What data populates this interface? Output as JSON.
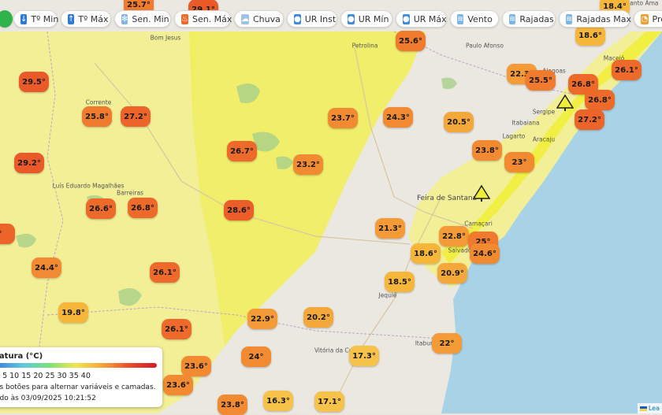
{
  "toolbar": {
    "buttons": [
      {
        "label": "Tº Min",
        "icon": "down-arrow-icon"
      },
      {
        "label": "Tº Máx",
        "icon": "up-arrow-icon"
      },
      {
        "label": "Sen. Min",
        "icon": "snowflake-icon"
      },
      {
        "label": "Sen. Máx",
        "icon": "flame-icon"
      },
      {
        "label": "Chuva",
        "icon": "rain-cloud-icon"
      },
      {
        "label": "UR Inst",
        "icon": "droplet-icon"
      },
      {
        "label": "UR Mín",
        "icon": "droplet-icon"
      },
      {
        "label": "UR Máx",
        "icon": "droplet-icon"
      },
      {
        "label": "Vento",
        "icon": "wind-icon"
      },
      {
        "label": "Rajadas",
        "icon": "wind-icon"
      },
      {
        "label": "Rajadas Max",
        "icon": "wind-icon"
      },
      {
        "label": "Pre",
        "icon": "gauge-icon"
      }
    ]
  },
  "legend": {
    "title": "ratura (°C)",
    "scale": "0 5 10 15 20 25 30 35 40",
    "note": "os botões para alternar variáveis e camadas.",
    "updated": "ado às 03/09/2025 10:21:52"
  },
  "attribution": "Lea",
  "cities": [
    {
      "name": "Bom Jesus"
    },
    {
      "name": "Petrolina"
    },
    {
      "name": "Paulo Afonso"
    },
    {
      "name": "Alagoas"
    },
    {
      "name": "Maceió"
    },
    {
      "name": "Santo Ama"
    },
    {
      "name": "Sergipe"
    },
    {
      "name": "Itabaiana"
    },
    {
      "name": "Lagarto"
    },
    {
      "name": "Aracaju"
    },
    {
      "name": "Corrente"
    },
    {
      "name": "Luís Eduardo Magalhães"
    },
    {
      "name": "Barreiras"
    },
    {
      "name": "Feira de Santana"
    },
    {
      "name": "Camaçari"
    },
    {
      "name": "Salvador"
    },
    {
      "name": "Jequié"
    },
    {
      "name": "Vitória da Conquista"
    },
    {
      "name": "Itabuna"
    }
  ],
  "temperature_markers": [
    {
      "value": "25.7°",
      "color": "#f07a2e"
    },
    {
      "value": "29.1°",
      "color": "#ea5a28"
    },
    {
      "value": "18.4°",
      "color": "#f5b63a"
    },
    {
      "value": "25.6°",
      "color": "#f07a2e"
    },
    {
      "value": "18.6°",
      "color": "#f5b63a"
    },
    {
      "value": "22.3°",
      "color": "#f49a36"
    },
    {
      "value": "25.5°",
      "color": "#f07a2e"
    },
    {
      "value": "26.8°",
      "color": "#ee6a2a"
    },
    {
      "value": "26.1°",
      "color": "#ee6a2a"
    },
    {
      "value": "26.8°",
      "color": "#ee6a2a"
    },
    {
      "value": "27.2°",
      "color": "#ec642a"
    },
    {
      "value": "29.5°",
      "color": "#ea5a28"
    },
    {
      "value": "25.8°",
      "color": "#f07a2e"
    },
    {
      "value": "27.2°",
      "color": "#ec642a"
    },
    {
      "value": "23.7°",
      "color": "#f28a32"
    },
    {
      "value": "24.3°",
      "color": "#f28a32"
    },
    {
      "value": "20.5°",
      "color": "#f5a83a"
    },
    {
      "value": "23.8°",
      "color": "#f28a32"
    },
    {
      "value": "29.2°",
      "color": "#ea5a28"
    },
    {
      "value": "26.7°",
      "color": "#ee6a2a"
    },
    {
      "value": "23.2°",
      "color": "#f28a32"
    },
    {
      "value": "23°",
      "color": "#f28a32"
    },
    {
      "value": "26.6°",
      "color": "#ee6a2a"
    },
    {
      "value": "26.8°",
      "color": "#ee6a2a"
    },
    {
      "value": "28.6°",
      "color": "#eb5e29"
    },
    {
      "value": "°",
      "color": "#ec642a"
    },
    {
      "value": "21.3°",
      "color": "#f49a36"
    },
    {
      "value": "22.8°",
      "color": "#f49a36"
    },
    {
      "value": "25°",
      "color": "#f07a2e"
    },
    {
      "value": "18.6°",
      "color": "#f5b63a"
    },
    {
      "value": "24.6°",
      "color": "#f28a32"
    },
    {
      "value": "24.4°",
      "color": "#f28a32"
    },
    {
      "value": "26.1°",
      "color": "#ee6a2a"
    },
    {
      "value": "20.9°",
      "color": "#f5a83a"
    },
    {
      "value": "18.5°",
      "color": "#f5b63a"
    },
    {
      "value": "19.8°",
      "color": "#f5b63a"
    },
    {
      "value": "22.9°",
      "color": "#f49a36"
    },
    {
      "value": "20.2°",
      "color": "#f5a83a"
    },
    {
      "value": "26.1°",
      "color": "#ee6a2a"
    },
    {
      "value": "24°",
      "color": "#f28a32"
    },
    {
      "value": "17.3°",
      "color": "#f7c24a"
    },
    {
      "value": "22°",
      "color": "#f49a36"
    },
    {
      "value": "23.6°",
      "color": "#f28a32"
    },
    {
      "value": "23.6°",
      "color": "#f28a32"
    },
    {
      "value": "23.8°",
      "color": "#f28a32"
    },
    {
      "value": "16.3°",
      "color": "#f7c24a"
    },
    {
      "value": "17.1°",
      "color": "#f7c24a"
    }
  ]
}
